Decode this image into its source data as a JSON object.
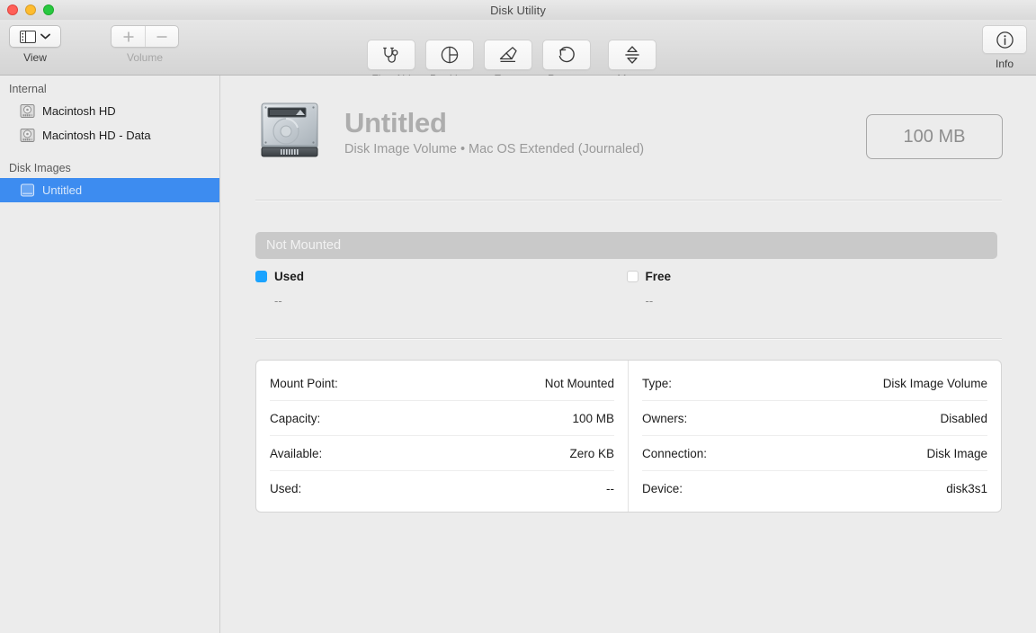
{
  "window": {
    "title": "Disk Utility",
    "traffic_lights": [
      "close-button",
      "minimize-button",
      "maximize-button"
    ]
  },
  "toolbar": {
    "view": {
      "label": "View",
      "icon": "sidebar-view-icon",
      "chevron": "chevron-down-icon"
    },
    "volume": {
      "label": "Volume",
      "add_icon": "plus-icon",
      "remove_icon": "minus-icon"
    },
    "tools": [
      {
        "label": "First Aid",
        "icon": "stethoscope-icon"
      },
      {
        "label": "Partition",
        "icon": "pie-partition-icon"
      },
      {
        "label": "Erase",
        "icon": "eraser-icon"
      },
      {
        "label": "Restore",
        "icon": "undo-arrow-icon"
      },
      {
        "label": "Mount",
        "icon": "mount-eject-icon"
      }
    ],
    "info": {
      "label": "Info",
      "icon": "info-circle-icon"
    }
  },
  "sidebar": {
    "sections": [
      {
        "header": "Internal",
        "items": [
          {
            "label": "Macintosh HD",
            "icon": "hard-disk-icon",
            "selected": false
          },
          {
            "label": "Macintosh HD - Data",
            "icon": "hard-disk-icon",
            "selected": false
          }
        ]
      },
      {
        "header": "Disk Images",
        "items": [
          {
            "label": "Untitled",
            "icon": "disk-image-icon",
            "selected": true
          }
        ]
      }
    ],
    "selection_color": "#3d8cf0"
  },
  "main": {
    "volume": {
      "icon": "hard-drive-large-icon",
      "name": "Untitled",
      "subtitle": "Disk Image Volume • Mac OS Extended (Journaled)",
      "capacity_badge": "100 MB"
    },
    "usage_bar": {
      "status_text": "Not Mounted",
      "bar_color": "#c9c9c9",
      "legend": [
        {
          "name": "Used",
          "value": "--",
          "color": "#1aa3ff"
        },
        {
          "name": "Free",
          "value": "--",
          "color": "#ffffff"
        }
      ]
    },
    "info": {
      "left": [
        {
          "key": "Mount Point:",
          "value": "Not Mounted"
        },
        {
          "key": "Capacity:",
          "value": "100 MB"
        },
        {
          "key": "Available:",
          "value": "Zero KB"
        },
        {
          "key": "Used:",
          "value": "--"
        }
      ],
      "right": [
        {
          "key": "Type:",
          "value": "Disk Image Volume"
        },
        {
          "key": "Owners:",
          "value": "Disabled"
        },
        {
          "key": "Connection:",
          "value": "Disk Image"
        },
        {
          "key": "Device:",
          "value": "disk3s1"
        }
      ]
    }
  }
}
